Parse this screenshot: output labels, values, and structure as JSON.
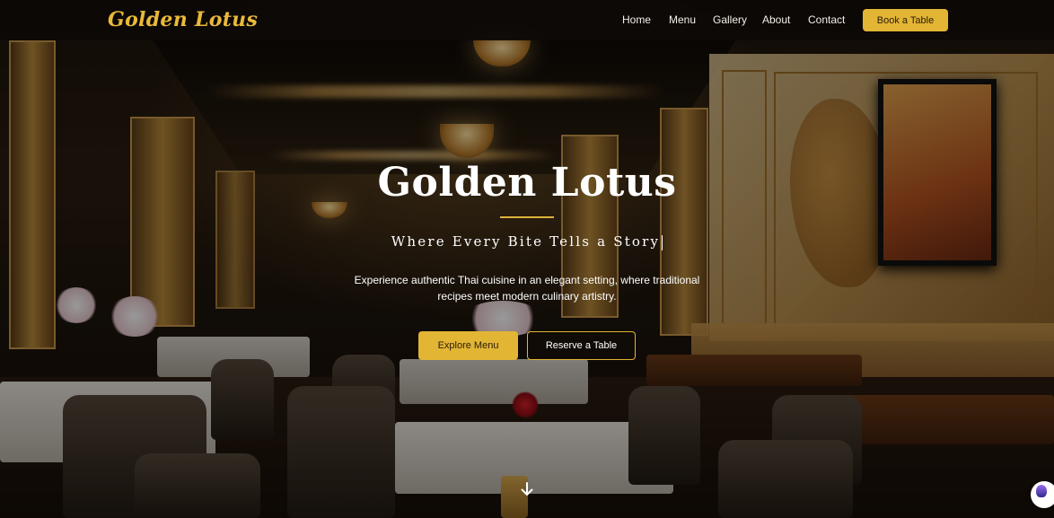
{
  "brand": {
    "name": "Golden Lotus"
  },
  "nav": {
    "links": [
      "Home",
      "Menu",
      "Gallery",
      "About",
      "Contact"
    ],
    "cta": "Book a Table"
  },
  "hero": {
    "title": "Golden Lotus",
    "tagline": "Where Every Bite Tells a Story",
    "description_line1": "Experience authentic Thai cuisine in an elegant setting, where traditional",
    "description_line2": "recipes meet modern culinary artistry.",
    "primary_button": "Explore Menu",
    "secondary_button": "Reserve a Table"
  },
  "icons": {
    "scroll": "arrow-down-icon",
    "chat": "chat-widget-icon"
  },
  "colors": {
    "accent": "#e2b534",
    "header_bg": "#0c0906",
    "text": "#ffffff"
  }
}
